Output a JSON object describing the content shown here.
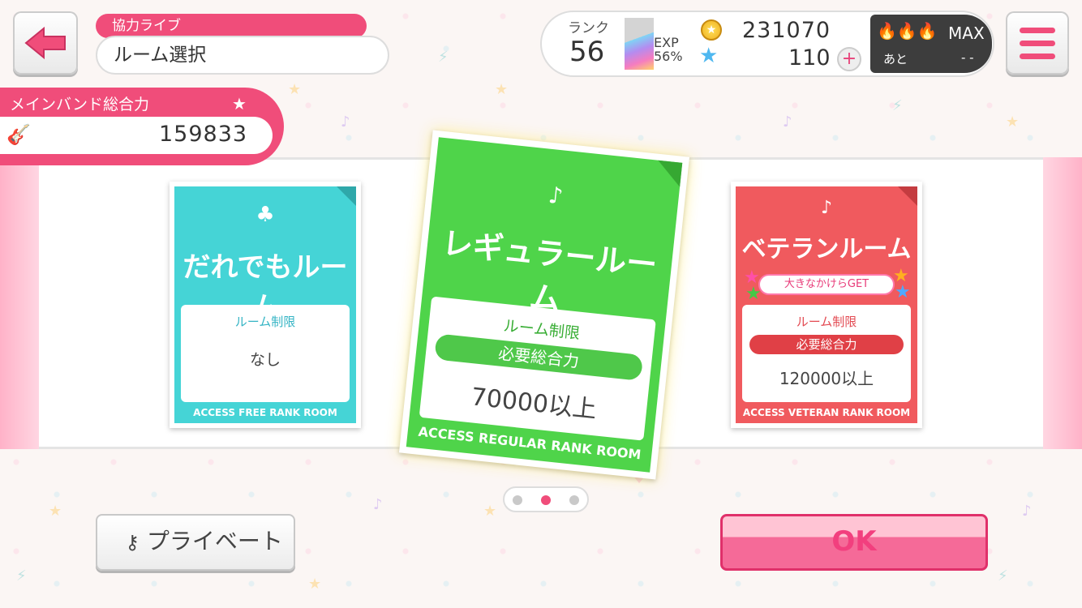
{
  "header": {
    "category": "協力ライブ",
    "title": "ルーム選択"
  },
  "player": {
    "rank_label": "ランク",
    "rank": "56",
    "exp_label": "EXP",
    "exp_percent": "56%",
    "coins": "231070",
    "stars": "110",
    "plus": "+",
    "boost_max": "MAX",
    "boost_remaining_label": "あと",
    "boost_remaining_value": "- -"
  },
  "band": {
    "label": "メインバンド総合力",
    "value": "159833"
  },
  "rooms": [
    {
      "title": "だれでもルーム",
      "limit_label": "ルーム制限",
      "requirement_label": "",
      "requirement_value": "なし",
      "footer": "ACCESS FREE RANK ROOM",
      "color": "#45d4d6"
    },
    {
      "title": "レギュラールーム",
      "limit_label": "ルーム制限",
      "requirement_label": "必要総合力",
      "requirement_value": "70000以上",
      "footer": "ACCESS REGULAR RANK ROOM",
      "color": "#4fd44a"
    },
    {
      "title": "ベテランルーム",
      "badge": "大きなかけらGET",
      "limit_label": "ルーム制限",
      "requirement_label": "必要総合力",
      "requirement_value": "120000以上",
      "footer": "ACCESS VETERAN RANK ROOM",
      "color": "#f05a5e"
    }
  ],
  "pager": {
    "count": 3,
    "active": 2
  },
  "buttons": {
    "private": "プライベート",
    "ok": "OK"
  },
  "icons": {
    "back": "back-arrow-icon",
    "menu": "hamburger-icon",
    "coin": "coin-icon",
    "star": "star-icon",
    "fire": "fire-icon",
    "guitar": "guitar-icon",
    "key": "key-icon"
  },
  "colors": {
    "accent": "#f04d7a",
    "ok_text": "#f23f7e"
  }
}
